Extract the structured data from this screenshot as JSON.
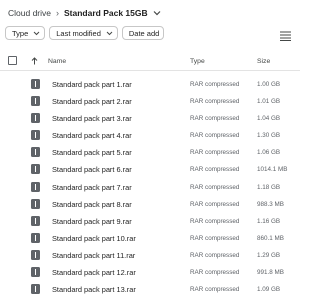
{
  "breadcrumb": {
    "root": "Cloud drive",
    "separator": "›",
    "current": "Standard Pack 15GB"
  },
  "filters": [
    {
      "label": "Type"
    },
    {
      "label": "Last modified"
    },
    {
      "label": "Date add"
    }
  ],
  "table": {
    "columns": {
      "name": "Name",
      "type": "Type",
      "size": "Size"
    },
    "rows": [
      {
        "name": "Standard pack part 1.rar",
        "type": "RAR compressed",
        "size": "1.00 GB"
      },
      {
        "name": "Standard pack part 2.rar",
        "type": "RAR compressed",
        "size": "1.01 GB"
      },
      {
        "name": "Standard pack part 3.rar",
        "type": "RAR compressed",
        "size": "1.04 GB"
      },
      {
        "name": "Standard pack part 4.rar",
        "type": "RAR compressed",
        "size": "1.30 GB"
      },
      {
        "name": "Standard pack part 5.rar",
        "type": "RAR compressed",
        "size": "1.06 GB"
      },
      {
        "name": "Standard pack part 6.rar",
        "type": "RAR compressed",
        "size": "1014.1 MB"
      },
      {
        "name": "Standard pack part 7.rar",
        "type": "RAR compressed",
        "size": "1.18 GB"
      },
      {
        "name": "Standard pack part 8.rar",
        "type": "RAR compressed",
        "size": "988.3 MB"
      },
      {
        "name": "Standard pack part 9.rar",
        "type": "RAR compressed",
        "size": "1.16 GB"
      },
      {
        "name": "Standard pack part 10.rar",
        "type": "RAR compressed",
        "size": "860.1 MB"
      },
      {
        "name": "Standard pack part 11.rar",
        "type": "RAR compressed",
        "size": "1.29 GB"
      },
      {
        "name": "Standard pack part 12.rar",
        "type": "RAR compressed",
        "size": "991.8 MB"
      },
      {
        "name": "Standard pack part 13.rar",
        "type": "RAR compressed",
        "size": "1.09 GB"
      }
    ]
  },
  "icons": {
    "file": "archive-file-icon",
    "sort": "arrow-up-icon",
    "view": "list-view-icon",
    "chevron": "chevron-down-icon"
  },
  "colors": {
    "icon": "#5f6368",
    "text": "#1f1f1f",
    "muted": "#5f6368",
    "border": "#c7c7c7"
  }
}
